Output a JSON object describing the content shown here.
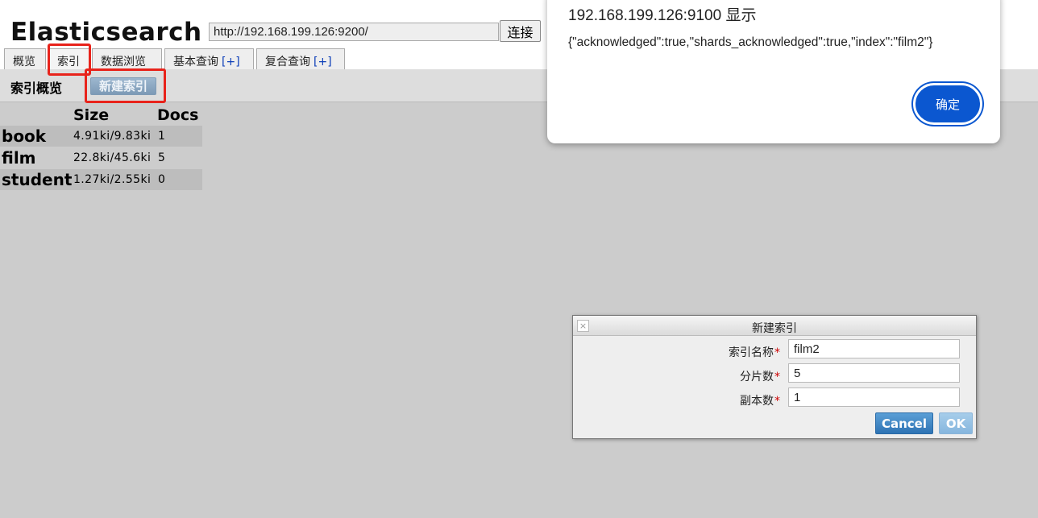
{
  "colors": {
    "background": "#cccccc",
    "highlight": "#e8231b",
    "link_plus": "#0b3db8",
    "primary_button": "#0b57d0",
    "cancel_button": "#2e73b4"
  },
  "app": {
    "title": "Elasticsearch",
    "url": "http://192.168.199.126:9200/",
    "connect_label": "连接"
  },
  "tabs": [
    {
      "label": "概览",
      "plus": ""
    },
    {
      "label": "索引",
      "plus": ""
    },
    {
      "label": "数据浏览",
      "plus": ""
    },
    {
      "label": "基本查询",
      "plus": "[+]"
    },
    {
      "label": "复合查询",
      "plus": "[+]"
    }
  ],
  "toolbar": {
    "title": "索引概览",
    "new_index_label": "新建索引"
  },
  "index_table": {
    "headers": {
      "size": "Size",
      "docs": "Docs"
    },
    "rows": [
      {
        "name": "book",
        "size": "4.91ki/9.83ki",
        "docs": "1"
      },
      {
        "name": "film",
        "size": "22.8ki/45.6ki",
        "docs": "5"
      },
      {
        "name": "student",
        "size": "1.27ki/2.55ki",
        "docs": "0"
      }
    ]
  },
  "alert": {
    "title": "192.168.199.126:9100 显示",
    "message": "{\"acknowledged\":true,\"shards_acknowledged\":true,\"index\":\"film2\"}",
    "ok_label": "确定"
  },
  "dialog": {
    "title": "新建索引",
    "close_glyph": "×",
    "fields": [
      {
        "label": "索引名称",
        "required_mark": "*",
        "value": "film2"
      },
      {
        "label": "分片数",
        "required_mark": "*",
        "value": "5"
      },
      {
        "label": "副本数",
        "required_mark": "*",
        "value": "1"
      }
    ],
    "cancel_label": "Cancel",
    "ok_label": "OK"
  }
}
